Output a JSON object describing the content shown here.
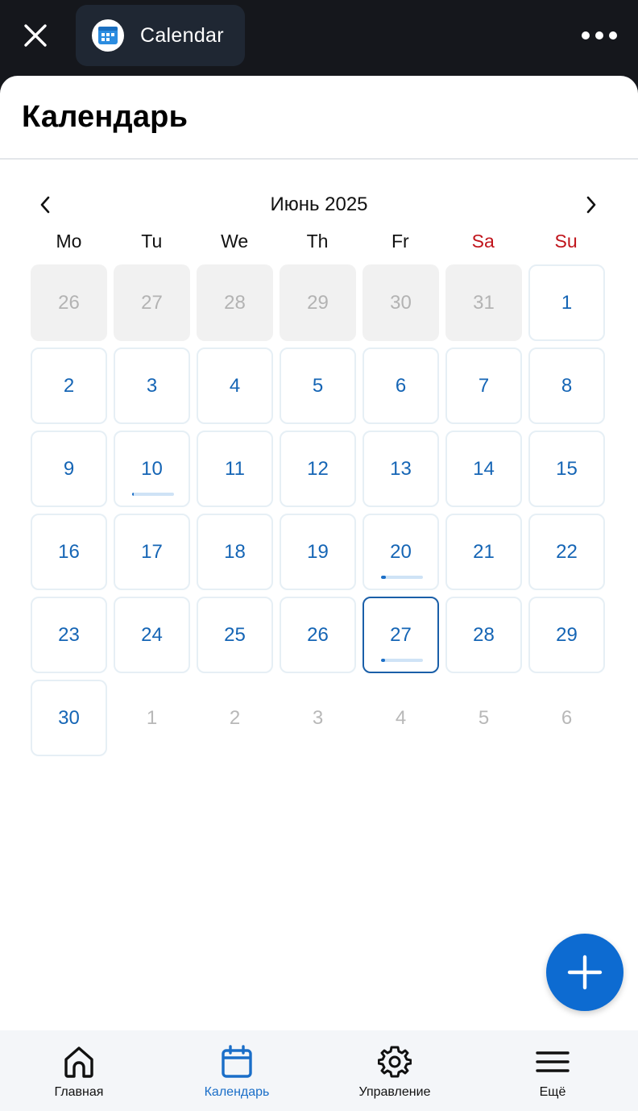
{
  "topbar": {
    "app_title": "Calendar",
    "close_icon": "close-icon",
    "more_icon": "more-horizontal-icon",
    "app_icon": "calendar-app-icon"
  },
  "page": {
    "title": "Календарь"
  },
  "calendar": {
    "month_label": "Июнь 2025",
    "weekdays": [
      "Mo",
      "Tu",
      "We",
      "Th",
      "Fr",
      "Sa",
      "Su"
    ],
    "weekend_color": "#c0141b",
    "accent_color": "#1565b5",
    "days": [
      {
        "n": "26",
        "type": "outside-before"
      },
      {
        "n": "27",
        "type": "outside-before"
      },
      {
        "n": "28",
        "type": "outside-before"
      },
      {
        "n": "29",
        "type": "outside-before"
      },
      {
        "n": "30",
        "type": "outside-before"
      },
      {
        "n": "31",
        "type": "outside-before"
      },
      {
        "n": "1",
        "type": "in-month"
      },
      {
        "n": "2",
        "type": "in-month"
      },
      {
        "n": "3",
        "type": "in-month"
      },
      {
        "n": "4",
        "type": "in-month"
      },
      {
        "n": "5",
        "type": "in-month"
      },
      {
        "n": "6",
        "type": "in-month"
      },
      {
        "n": "7",
        "type": "in-month"
      },
      {
        "n": "8",
        "type": "in-month"
      },
      {
        "n": "9",
        "type": "in-month"
      },
      {
        "n": "10",
        "type": "in-month",
        "progress": 0.02
      },
      {
        "n": "11",
        "type": "in-month"
      },
      {
        "n": "12",
        "type": "in-month"
      },
      {
        "n": "13",
        "type": "in-month"
      },
      {
        "n": "14",
        "type": "in-month"
      },
      {
        "n": "15",
        "type": "in-month"
      },
      {
        "n": "16",
        "type": "in-month"
      },
      {
        "n": "17",
        "type": "in-month"
      },
      {
        "n": "18",
        "type": "in-month"
      },
      {
        "n": "19",
        "type": "in-month"
      },
      {
        "n": "20",
        "type": "in-month",
        "progress": 0.12
      },
      {
        "n": "21",
        "type": "in-month"
      },
      {
        "n": "22",
        "type": "in-month"
      },
      {
        "n": "23",
        "type": "in-month"
      },
      {
        "n": "24",
        "type": "in-month"
      },
      {
        "n": "25",
        "type": "in-month"
      },
      {
        "n": "26",
        "type": "in-month"
      },
      {
        "n": "27",
        "type": "in-month",
        "today": true,
        "progress": 0.1
      },
      {
        "n": "28",
        "type": "in-month"
      },
      {
        "n": "29",
        "type": "in-month"
      },
      {
        "n": "30",
        "type": "in-month"
      },
      {
        "n": "1",
        "type": "outside-after"
      },
      {
        "n": "2",
        "type": "outside-after"
      },
      {
        "n": "3",
        "type": "outside-after"
      },
      {
        "n": "4",
        "type": "outside-after"
      },
      {
        "n": "5",
        "type": "outside-after"
      },
      {
        "n": "6",
        "type": "outside-after"
      }
    ]
  },
  "fab": {
    "icon": "plus-icon",
    "color": "#0d6bd1"
  },
  "bottom_nav": {
    "items": [
      {
        "label": "Главная",
        "icon": "home-icon"
      },
      {
        "label": "Календарь",
        "icon": "calendar-icon",
        "active": true
      },
      {
        "label": "Управление",
        "icon": "gear-icon"
      },
      {
        "label": "Ещё",
        "icon": "menu-icon"
      }
    ]
  }
}
